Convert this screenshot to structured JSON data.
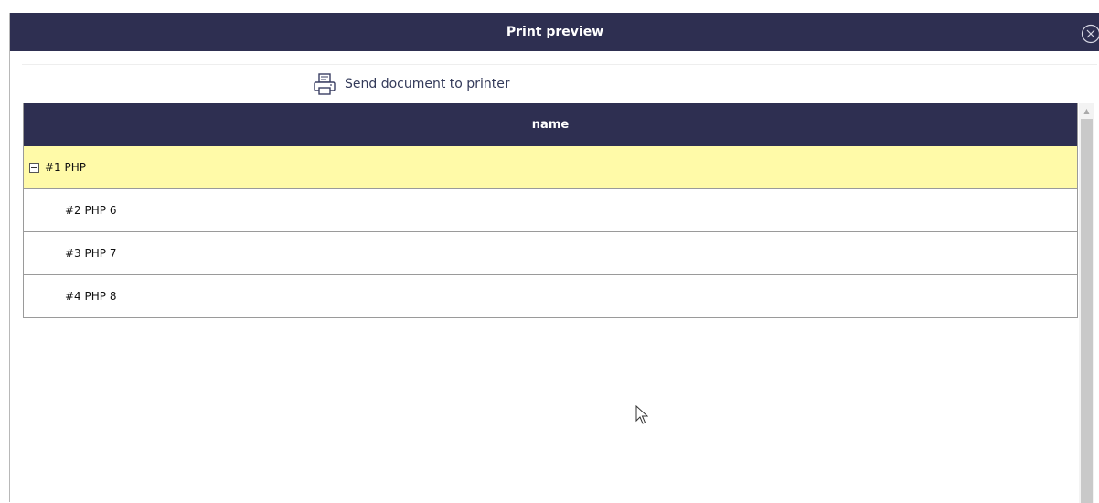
{
  "dialog": {
    "title": "Print preview",
    "close_icon": "close-circle-icon"
  },
  "toolbar": {
    "print_label": "Send document to printer",
    "print_icon": "printer-icon"
  },
  "grid": {
    "column_header": "name",
    "rows": [
      {
        "label": "#1 PHP",
        "expanded": true,
        "selected": true
      },
      {
        "label": "#2 PHP 6"
      },
      {
        "label": "#3 PHP 7"
      },
      {
        "label": "#4 PHP 8"
      }
    ]
  },
  "colors": {
    "header_bg": "#2e2f51",
    "selected_row_bg": "#fffaa8"
  }
}
